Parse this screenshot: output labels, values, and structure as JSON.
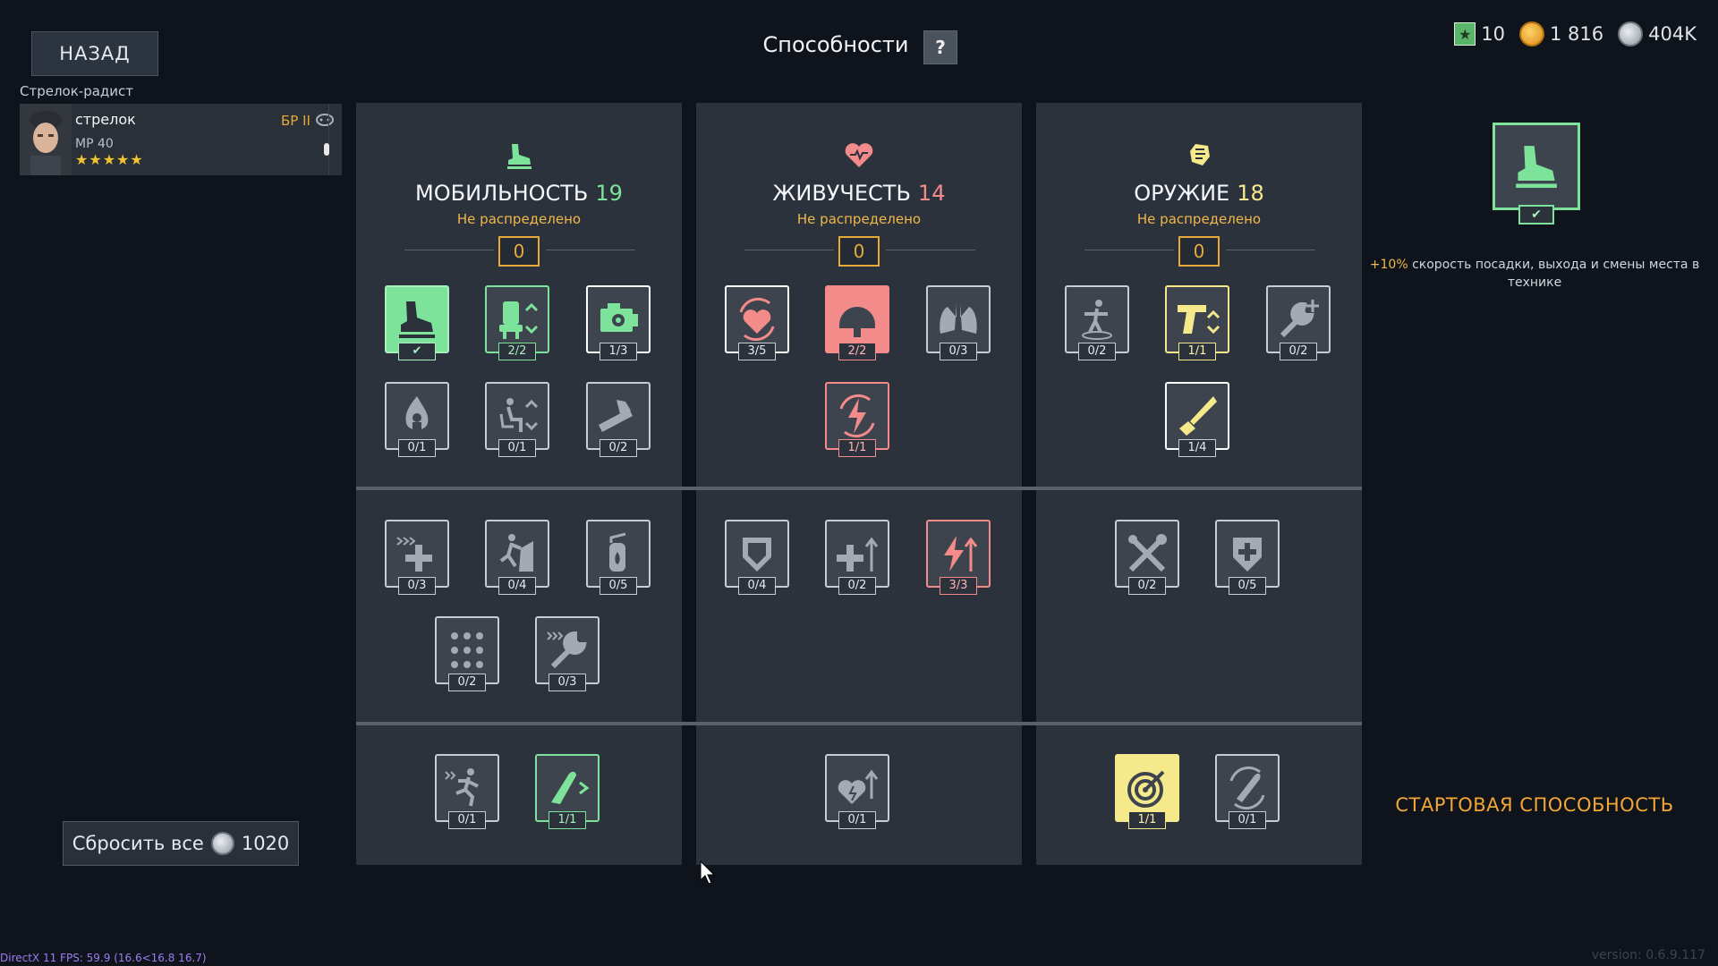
{
  "header": {
    "back_label": "НАЗАД",
    "title": "Способности",
    "help_label": "?"
  },
  "currency": {
    "stars": "10",
    "gold": "1 816",
    "silver": "404K"
  },
  "crew": {
    "role": "Стрелок-радист",
    "name": "стрелок",
    "weapon": "MP 40",
    "stars": "★★★★★",
    "br": "БР II"
  },
  "panels": {
    "mobility": {
      "title": "МОБИЛЬНОСТЬ",
      "points": "19",
      "unassigned_label": "Не распределено",
      "unassigned": "0",
      "color": "#7ee39a"
    },
    "vitality": {
      "title": "ЖИВУЧЕСТЬ",
      "points": "14",
      "unassigned_label": "Не распределено",
      "unassigned": "0",
      "color": "#f38b8b"
    },
    "weapons": {
      "title": "ОРУЖИЕ",
      "points": "18",
      "unassigned_label": "Не распределено",
      "unassigned": "0",
      "color": "#f5e98b"
    }
  },
  "skills": {
    "mob": [
      "",
      "2/2",
      "1/3",
      "0/1",
      "0/1",
      "0/2",
      "0/3",
      "0/4",
      "0/5",
      "0/2",
      "0/3",
      "0/1",
      "1/1"
    ],
    "viv": [
      "3/5",
      "2/2",
      "0/3",
      "1/1",
      "0/4",
      "0/2",
      "3/3",
      "0/1"
    ],
    "wep": [
      "0/2",
      "1/1",
      "0/2",
      "1/4",
      "0/2",
      "0/5",
      "1/1",
      "0/1"
    ]
  },
  "preview": {
    "desc_highlight": "+10%",
    "desc_rest": " скорость посадки, выхода и смены места в технике",
    "starting_label": "СТАРТОВАЯ СПОСОБНОСТЬ"
  },
  "footer": {
    "reset_label": "Сбросить все",
    "reset_cost": "1020",
    "fps": "DirectX 11 FPS: 59.9 (16.6<16.8 16.7)",
    "version": "version: 0.6.9.117"
  }
}
